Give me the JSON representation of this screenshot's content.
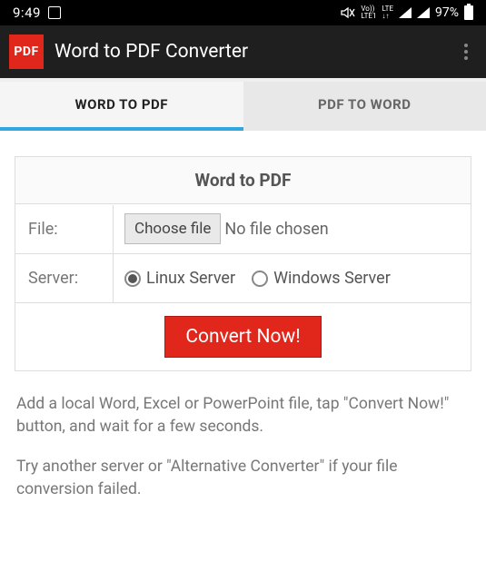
{
  "status": {
    "time": "9:49",
    "volte_top": "Vo))",
    "volte_bottom": "LTE1",
    "lte": "LTE",
    "battery": "97%"
  },
  "header": {
    "badge": "PDF",
    "title": "Word to PDF Converter"
  },
  "tabs": [
    {
      "label": "WORD TO PDF",
      "active": true
    },
    {
      "label": "PDF TO WORD",
      "active": false
    }
  ],
  "card": {
    "title": "Word to PDF",
    "file_label": "File:",
    "choose_button": "Choose file",
    "file_status": "No file chosen",
    "server_label": "Server:",
    "servers": [
      {
        "label": "Linux Server",
        "selected": true
      },
      {
        "label": "Windows Server",
        "selected": false
      }
    ],
    "convert_button": "Convert Now!"
  },
  "help": {
    "p1": "Add a local Word, Excel or PowerPoint file, tap \"Convert Now!\" button, and wait for a few seconds.",
    "p2": "Try another server or \"Alternative Converter\" if your file conversion failed."
  }
}
